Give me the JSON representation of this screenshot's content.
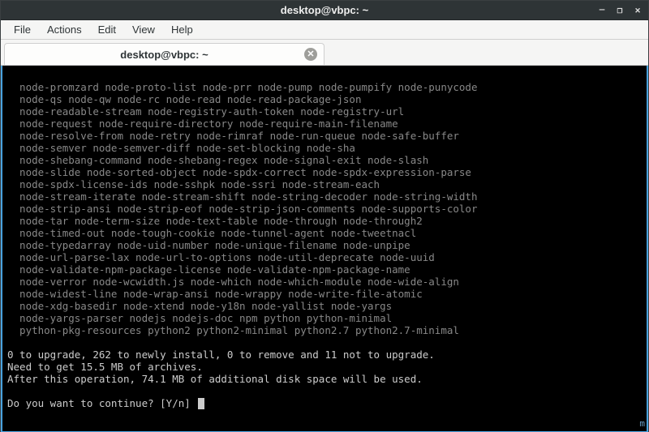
{
  "window": {
    "title": "desktop@vbpc: ~",
    "controls": {
      "minimize": "—",
      "maximize": "❐",
      "close": "✕"
    }
  },
  "menubar": {
    "items": [
      "File",
      "Actions",
      "Edit",
      "View",
      "Help"
    ]
  },
  "tab": {
    "label": "desktop@vbpc: ~",
    "close_glyph": "✕"
  },
  "terminal": {
    "package_lines": [
      "  node-promzard node-proto-list node-prr node-pump node-pumpify node-punycode",
      "  node-qs node-qw node-rc node-read node-read-package-json",
      "  node-readable-stream node-registry-auth-token node-registry-url",
      "  node-request node-require-directory node-require-main-filename",
      "  node-resolve-from node-retry node-rimraf node-run-queue node-safe-buffer",
      "  node-semver node-semver-diff node-set-blocking node-sha",
      "  node-shebang-command node-shebang-regex node-signal-exit node-slash",
      "  node-slide node-sorted-object node-spdx-correct node-spdx-expression-parse",
      "  node-spdx-license-ids node-sshpk node-ssri node-stream-each",
      "  node-stream-iterate node-stream-shift node-string-decoder node-string-width",
      "  node-strip-ansi node-strip-eof node-strip-json-comments node-supports-color",
      "  node-tar node-term-size node-text-table node-through node-through2",
      "  node-timed-out node-tough-cookie node-tunnel-agent node-tweetnacl",
      "  node-typedarray node-uid-number node-unique-filename node-unpipe",
      "  node-url-parse-lax node-url-to-options node-util-deprecate node-uuid",
      "  node-validate-npm-package-license node-validate-npm-package-name",
      "  node-verror node-wcwidth.js node-which node-which-module node-wide-align",
      "  node-widest-line node-wrap-ansi node-wrappy node-write-file-atomic",
      "  node-xdg-basedir node-xtend node-y18n node-yallist node-yargs",
      "  node-yargs-parser nodejs nodejs-doc npm python python-minimal",
      "  python-pkg-resources python2 python2-minimal python2.7 python2.7-minimal"
    ],
    "summary_lines": [
      "0 to upgrade, 262 to newly install, 0 to remove and 11 not to upgrade.",
      "Need to get 15.5 MB of archives.",
      "After this operation, 74.1 MB of additional disk space will be used."
    ],
    "prompt": "Do you want to continue? [Y/n] "
  },
  "watermark": "m"
}
